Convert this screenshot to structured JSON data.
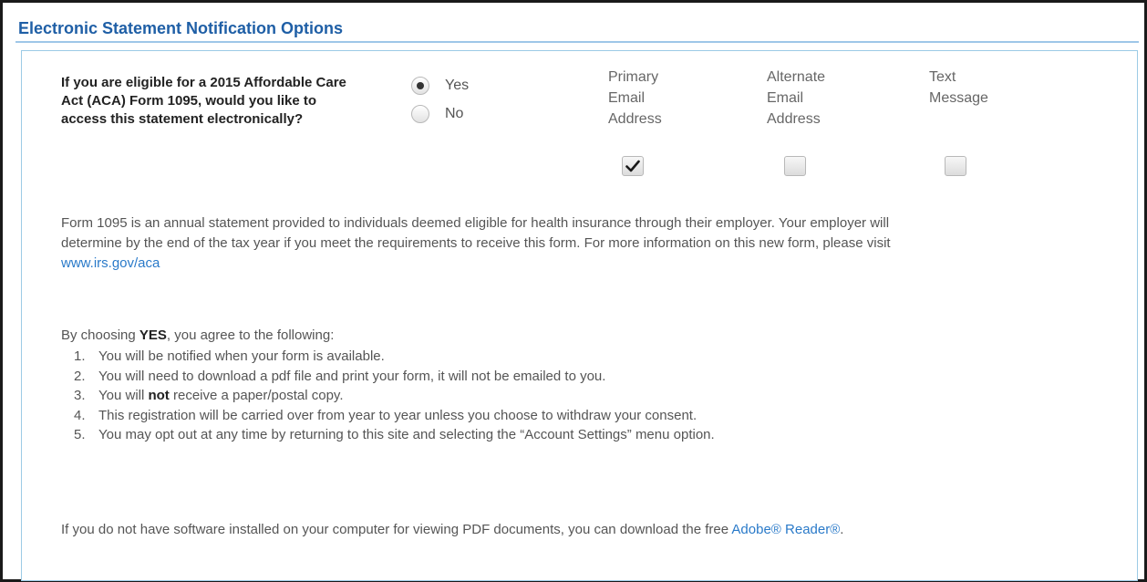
{
  "section": {
    "title": "Electronic Statement Notification Options"
  },
  "question": {
    "text": "If you are eligible for a 2015 Affordable Care Act (ACA) Form 1095, would you like to access this statement electronically?"
  },
  "radios": {
    "yes": {
      "label": "Yes",
      "checked": true
    },
    "no": {
      "label": "No",
      "checked": false
    }
  },
  "columns": {
    "primary": {
      "line1": "Primary",
      "line2": "Email",
      "line3": "Address",
      "checked": true
    },
    "alternate": {
      "line1": "Alternate",
      "line2": "Email",
      "line3": "Address",
      "checked": false
    },
    "text": {
      "line1": "Text",
      "line2": "Message",
      "checked": false
    }
  },
  "description": {
    "text": "Form 1095 is an annual statement provided to individuals deemed eligible for health insurance through their employer. Your employer will determine by the end of the tax year if you meet the requirements to receive this form. For more information on this new form, please visit",
    "link": "www.irs.gov/aca"
  },
  "agreement": {
    "intro_prefix": "By choosing",
    "intro_bold": "YES",
    "intro_suffix": ", you agree to the following:",
    "items": [
      {
        "num": "1.",
        "text": "You will be notified when your form is available."
      },
      {
        "num": "2.",
        "text": "You will need to download a pdf file and print your form, it will not be emailed to you."
      },
      {
        "num": "3.",
        "pre": "You will",
        "bold": "not",
        "post": "receive a paper/postal copy."
      },
      {
        "num": "4.",
        "text": "This registration will be carried over from year to year unless you choose to withdraw your consent."
      },
      {
        "num": "5.",
        "text": "You may opt out at any time by returning to this site and selecting the “Account Settings” menu option."
      }
    ]
  },
  "footer": {
    "text": "If you do not have software installed on your computer for viewing PDF documents, you can download the free",
    "link": "Adobe® Reader®",
    "suffix": "."
  }
}
